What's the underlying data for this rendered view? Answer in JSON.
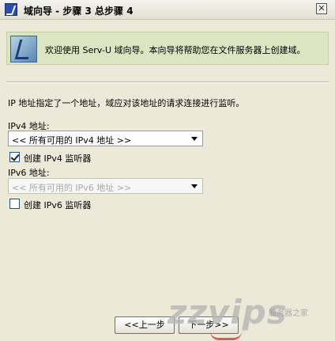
{
  "window": {
    "title": "域向导 - 步骤 3 总步骤 4",
    "close_glyph": "✕"
  },
  "banner": {
    "text": "欢迎使用 Serv-U 域向导。本向导将帮助您在文件服务器上创建域。"
  },
  "description": "IP 地址指定了一个地址，域应对该地址的请求连接进行监听。",
  "ipv4": {
    "label": "IPv4 地址:",
    "selected": "<< 所有可用的 IPv4 地址 >>",
    "create_listener_label": "创建 IPv4 监听器",
    "create_listener_checked": true
  },
  "ipv6": {
    "label": "IPv6 地址:",
    "selected": "<< 所有可用的 IPv6 地址 >>",
    "enabled": false,
    "create_listener_label": "创建 IPv6 监听器",
    "create_listener_checked": false
  },
  "buttons": {
    "back": "<<上一步",
    "next": "下一步>>"
  },
  "watermark": {
    "text": "zzvips",
    "sub": "服务器之家",
    "domain": ".com"
  },
  "colors": {
    "background": "#ece9d8",
    "banner": "#dbe5c2",
    "watermark_accent": "#d03a3a"
  }
}
